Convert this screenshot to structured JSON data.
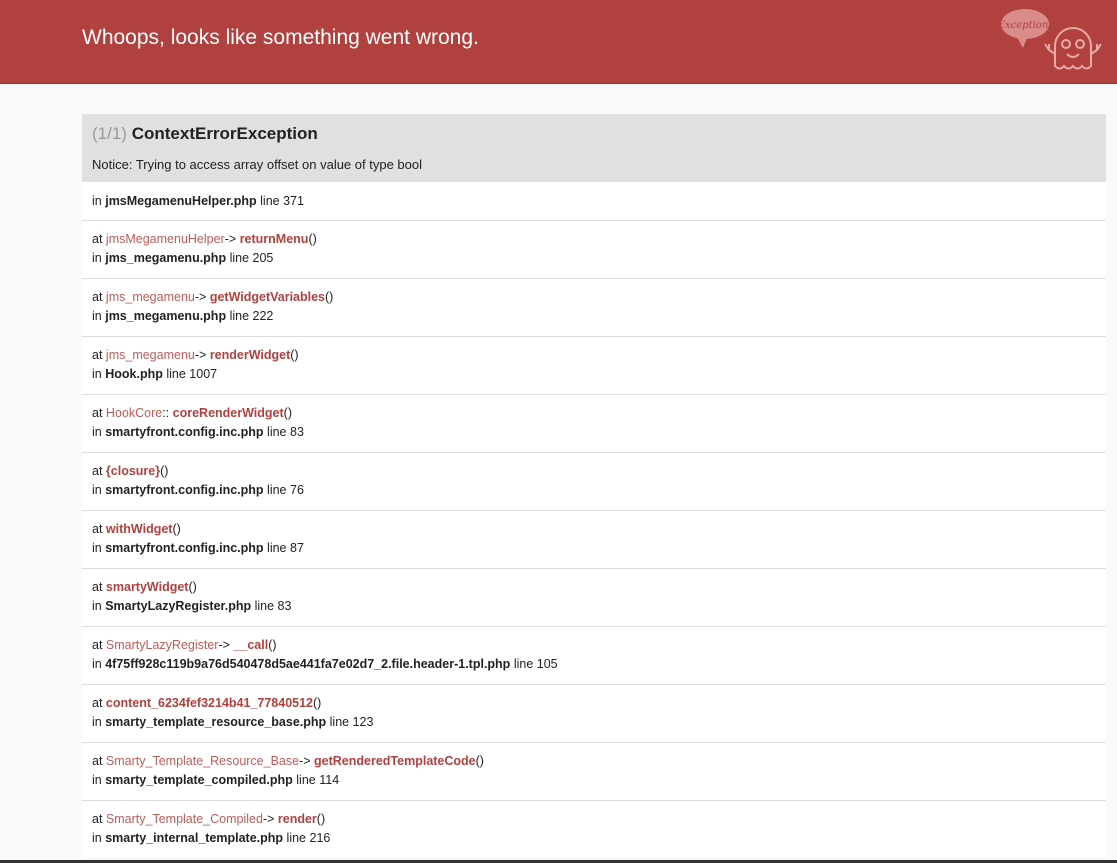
{
  "header": {
    "title": "Whoops, looks like something went wrong.",
    "logo_text": "Exception!"
  },
  "exception": {
    "count": "(1/1)",
    "name": "ContextErrorException",
    "message": "Notice: Trying to access array offset on value of type bool",
    "file": "jmsMegamenuHelper.php",
    "line": "371"
  },
  "labels": {
    "in": "in",
    "at": "at",
    "line": "line",
    "parens": "()"
  },
  "colors": {
    "header": "#b0413e",
    "accent": "#b0413e"
  },
  "trace": [
    {
      "class": "jmsMegamenuHelper",
      "sep": "->",
      "function": "returnMenu",
      "file": "jms_megamenu.php",
      "line": "205"
    },
    {
      "class": "jms_megamenu",
      "sep": "->",
      "function": "getWidgetVariables",
      "file": "jms_megamenu.php",
      "line": "222"
    },
    {
      "class": "jms_megamenu",
      "sep": "->",
      "function": "renderWidget",
      "file": "Hook.php",
      "line": "1007"
    },
    {
      "class": "HookCore",
      "sep": "::",
      "function": "coreRenderWidget",
      "file": "smartyfront.config.inc.php",
      "line": "83"
    },
    {
      "class": "",
      "sep": "",
      "function": "{closure}",
      "file": "smartyfront.config.inc.php",
      "line": "76"
    },
    {
      "class": "",
      "sep": "",
      "function": "withWidget",
      "file": "smartyfront.config.inc.php",
      "line": "87"
    },
    {
      "class": "",
      "sep": "",
      "function": "smartyWidget",
      "file": "SmartyLazyRegister.php",
      "line": "83"
    },
    {
      "class": "SmartyLazyRegister",
      "sep": "->",
      "function": "__call",
      "file": "4f75ff928c119b9a76d540478d5ae441fa7e02d7_2.file.header-1.tpl.php",
      "line": "105"
    },
    {
      "class": "",
      "sep": "",
      "function": "content_6234fef3214b41_77840512",
      "file": "smarty_template_resource_base.php",
      "line": "123"
    },
    {
      "class": "Smarty_Template_Resource_Base",
      "sep": "->",
      "function": "getRenderedTemplateCode",
      "file": "smarty_template_compiled.php",
      "line": "114"
    },
    {
      "class": "Smarty_Template_Compiled",
      "sep": "->",
      "function": "render",
      "file": "smarty_internal_template.php",
      "line": "216"
    }
  ]
}
